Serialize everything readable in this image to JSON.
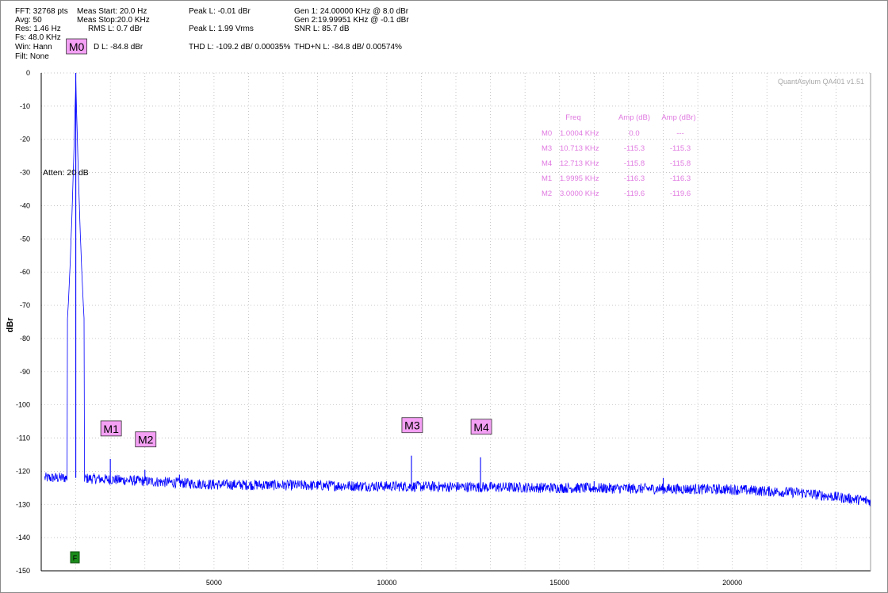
{
  "header": {
    "fft": "FFT: 32768 pts",
    "avg": "Avg: 50",
    "res": "Res: 1.46 Hz",
    "fs": "Fs: 48.0 KHz",
    "win": "Win: Hann",
    "filt": "Filt: None",
    "meas_start": "Meas Start: 20.0 Hz",
    "meas_stop": "Meas Stop:20.0 KHz",
    "rms": "RMS L: 0.7 dBr",
    "thd_n_partial": "D L: -84.8 dBr",
    "peak_l": "Peak L: -0.01 dBr",
    "peak_l_vrms": "Peak L: 1.99 Vrms",
    "thd_l": "THD L: -109.2 dB/ 0.00035%",
    "gen1": "Gen 1: 24.00000 KHz @ 8.0  dBr",
    "gen2": "Gen 2:19.99951 KHz @ -0.1  dBr",
    "snr": "SNR L: 85.7 dB",
    "thdn_l": "THD+N L: -84.8 dB/ 0.00574%"
  },
  "watermark": "QuantAsylum QA401 v1.51",
  "atten": "Atten: 20 dB",
  "flag_label": "F",
  "chart_data": {
    "type": "line",
    "title": "",
    "xlabel": "",
    "ylabel": "dBr",
    "xlim": [
      0,
      24000
    ],
    "ylim": [
      -150,
      0
    ],
    "x_ticks": [
      5000,
      10000,
      15000,
      20000
    ],
    "y_ticks": [
      0,
      -10,
      -20,
      -30,
      -40,
      -50,
      -60,
      -70,
      -80,
      -90,
      -100,
      -110,
      -120,
      -130,
      -140,
      -150
    ],
    "grid": true,
    "series": [
      {
        "color": "#0000ff",
        "noise_floor": [
          [
            0,
            -122
          ],
          [
            1000,
            -122
          ],
          [
            5000,
            -124
          ],
          [
            10000,
            -124.5
          ],
          [
            15000,
            -125
          ],
          [
            20000,
            -125.5
          ],
          [
            22000,
            -126.5
          ],
          [
            24000,
            -129
          ]
        ],
        "peaks": [
          {
            "x": 1000.4,
            "y": 0.0
          },
          {
            "x": 1999.5,
            "y": -116.3
          },
          {
            "x": 3000.0,
            "y": -119.6
          },
          {
            "x": 4000,
            "y": -121
          },
          {
            "x": 10713,
            "y": -115.3
          },
          {
            "x": 12713,
            "y": -115.8
          },
          {
            "x": 16000,
            "y": -123
          },
          {
            "x": 18000,
            "y": -122
          }
        ]
      }
    ],
    "markers": [
      {
        "label": "M0",
        "freq": 1000.4,
        "amp": 0.0
      },
      {
        "label": "M1",
        "freq": 1999.5,
        "amp": -116.3
      },
      {
        "label": "M2",
        "freq": 3000.0,
        "amp": -119.6
      },
      {
        "label": "M3",
        "freq": 10713,
        "amp": -115.3
      },
      {
        "label": "M4",
        "freq": 12713,
        "amp": -115.8
      }
    ],
    "marker_table": {
      "headers": [
        "Freq",
        "Amp (dB)",
        "Amp (dBr)"
      ],
      "rows": [
        [
          "M0",
          "1.0004 KHz",
          "0.0",
          "---"
        ],
        [
          "M3",
          "10.713 KHz",
          "-115.3",
          "-115.3"
        ],
        [
          "M4",
          "12.713 KHz",
          "-115.8",
          "-115.8"
        ],
        [
          "M1",
          "1.9995 KHz",
          "-116.3",
          "-116.3"
        ],
        [
          "M2",
          "3.0000 KHz",
          "-119.6",
          "-119.6"
        ]
      ]
    },
    "colors": {
      "trace": "#0000ff",
      "grid": "#b0b0b0",
      "marker_fill": "#f4a0f4",
      "table_text": "#e07ae0",
      "flag": "#1a8c1a"
    }
  }
}
